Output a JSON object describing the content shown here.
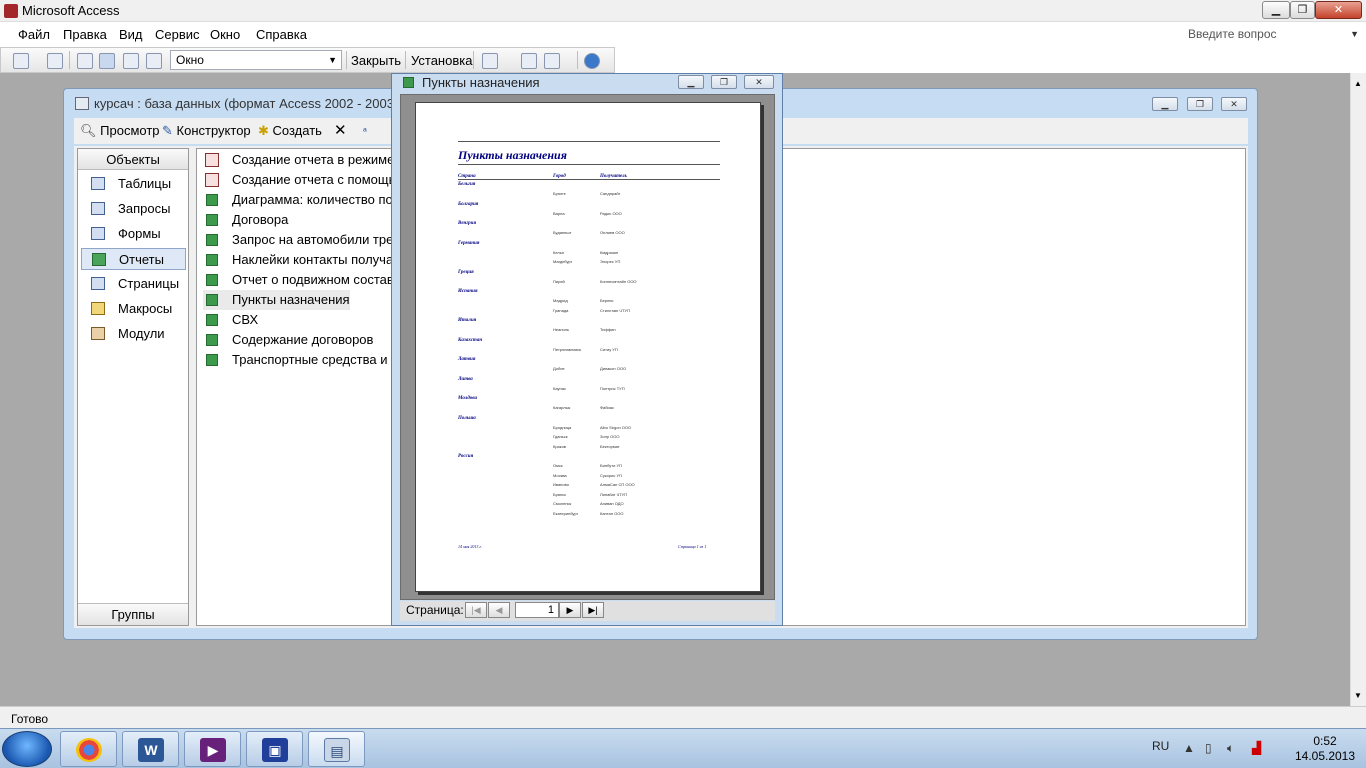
{
  "app": {
    "title": "Microsoft Access"
  },
  "menu": [
    "Файл",
    "Правка",
    "Вид",
    "Сервис",
    "Окно",
    "Справка"
  ],
  "help_box": {
    "placeholder": "Введите вопрос"
  },
  "toolbar": {
    "window_combo": "Окно",
    "close_label": "Закрыть",
    "setup_label": "Установка"
  },
  "db_window": {
    "title": "курсач : база данных (формат Access 2002 - 2003)",
    "toolbar": {
      "preview": "Просмотр",
      "design": "Конструктор",
      "create": "Создать"
    },
    "objects_header": "Объекты",
    "objects": [
      "Таблицы",
      "Запросы",
      "Формы",
      "Отчеты",
      "Страницы",
      "Макросы",
      "Модули"
    ],
    "selected_object": "Отчеты",
    "groups_label": "Группы",
    "reports": [
      "Создание отчета в режиме ко",
      "Создание отчета с помощью",
      "Диаграмма: количество поез",
      "Договора",
      "Запрос на автомобили требу",
      "Наклейки контакты получате",
      "Отчет о подвижном составе",
      "Пункты назначения",
      "СВХ",
      "Содержание договоров",
      "Транспортные средства и вод"
    ]
  },
  "preview": {
    "title": "Пункты назначения",
    "nav_label": "Страница:",
    "page_number": "1",
    "report": {
      "heading": "Пункты назначения",
      "columns": [
        "Страна",
        "Город",
        "Получатель"
      ],
      "countries": [
        {
          "name": "Бельгия",
          "rows": [
            [
              "Брюгге",
              "Сандпрайт"
            ]
          ]
        },
        {
          "name": "Болгария",
          "rows": [
            [
              "Варна",
              "Радис ООО"
            ]
          ]
        },
        {
          "name": "Венгрия",
          "rows": [
            [
              "Будапешт",
              "Онлиев ООО"
            ]
          ]
        },
        {
          "name": "Германия",
          "rows": [
            [
              "Кельн",
              "Кмдразин"
            ],
            [
              "Магдебург",
              "Элорес УП"
            ]
          ]
        },
        {
          "name": "Греция",
          "rows": [
            [
              "Пирей",
              "Коннесинтайн ООО"
            ]
          ]
        },
        {
          "name": "Испания",
          "rows": [
            [
              "Мадрид",
              "Бернис"
            ],
            [
              "Гранада",
              "Стилстаю ЧТУП"
            ]
          ]
        },
        {
          "name": "Италия",
          "rows": [
            [
              "Неаполь",
              "Тиффин"
            ]
          ]
        },
        {
          "name": "Казахстан",
          "rows": [
            [
              "Петропавловск",
              "Ситиу УП"
            ]
          ]
        },
        {
          "name": "Латвия",
          "rows": [
            [
              "Добле",
              "Динакон ООО"
            ]
          ]
        },
        {
          "name": "Литва",
          "rows": [
            [
              "Каунас",
              "Понтрис ТУП"
            ]
          ]
        },
        {
          "name": "Молдова",
          "rows": [
            [
              "Кагарлык",
              "Фабиас"
            ]
          ]
        },
        {
          "name": "Польша",
          "rows": [
            [
              "Бродница",
              "Albo Sirgon ООО"
            ],
            [
              "Гданьск",
              "Зонр ООО"
            ],
            [
              "Краков",
              "Бектормат"
            ]
          ]
        },
        {
          "name": "Россия",
          "rows": [
            [
              "Омск",
              "Бинбути УП"
            ],
            [
              "Москва",
              "Сукорис УП"
            ],
            [
              "Иваново",
              "АлмаСан СП ООО"
            ],
            [
              "Брянск",
              "Линабат ЧТУП"
            ],
            [
              "Смоленск",
              "Аниван ОДО"
            ],
            [
              "Екатеринбург",
              "Кантан ООО"
            ]
          ]
        }
      ],
      "footer_left": "14 мая 2013 г.",
      "footer_right": "Страница 1 из 1"
    }
  },
  "status": {
    "text": "Готово"
  },
  "tray": {
    "lang": "RU",
    "time": "0:52",
    "date": "14.05.2013"
  }
}
